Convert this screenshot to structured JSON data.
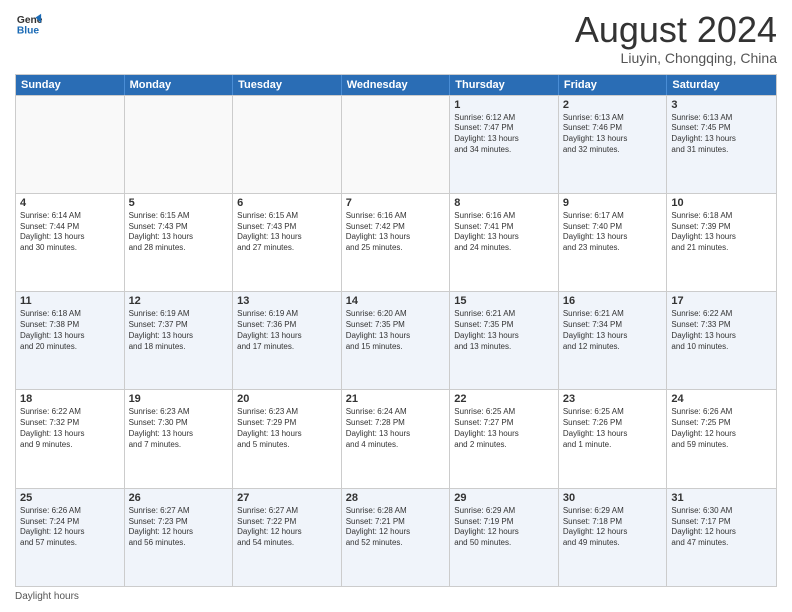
{
  "logo": {
    "line1": "General",
    "line2": "Blue"
  },
  "title": "August 2024",
  "subtitle": "Liuyin, Chongqing, China",
  "days_of_week": [
    "Sunday",
    "Monday",
    "Tuesday",
    "Wednesday",
    "Thursday",
    "Friday",
    "Saturday"
  ],
  "weeks": [
    [
      {
        "num": "",
        "info": ""
      },
      {
        "num": "",
        "info": ""
      },
      {
        "num": "",
        "info": ""
      },
      {
        "num": "",
        "info": ""
      },
      {
        "num": "1",
        "info": "Sunrise: 6:12 AM\nSunset: 7:47 PM\nDaylight: 13 hours\nand 34 minutes."
      },
      {
        "num": "2",
        "info": "Sunrise: 6:13 AM\nSunset: 7:46 PM\nDaylight: 13 hours\nand 32 minutes."
      },
      {
        "num": "3",
        "info": "Sunrise: 6:13 AM\nSunset: 7:45 PM\nDaylight: 13 hours\nand 31 minutes."
      }
    ],
    [
      {
        "num": "4",
        "info": "Sunrise: 6:14 AM\nSunset: 7:44 PM\nDaylight: 13 hours\nand 30 minutes."
      },
      {
        "num": "5",
        "info": "Sunrise: 6:15 AM\nSunset: 7:43 PM\nDaylight: 13 hours\nand 28 minutes."
      },
      {
        "num": "6",
        "info": "Sunrise: 6:15 AM\nSunset: 7:43 PM\nDaylight: 13 hours\nand 27 minutes."
      },
      {
        "num": "7",
        "info": "Sunrise: 6:16 AM\nSunset: 7:42 PM\nDaylight: 13 hours\nand 25 minutes."
      },
      {
        "num": "8",
        "info": "Sunrise: 6:16 AM\nSunset: 7:41 PM\nDaylight: 13 hours\nand 24 minutes."
      },
      {
        "num": "9",
        "info": "Sunrise: 6:17 AM\nSunset: 7:40 PM\nDaylight: 13 hours\nand 23 minutes."
      },
      {
        "num": "10",
        "info": "Sunrise: 6:18 AM\nSunset: 7:39 PM\nDaylight: 13 hours\nand 21 minutes."
      }
    ],
    [
      {
        "num": "11",
        "info": "Sunrise: 6:18 AM\nSunset: 7:38 PM\nDaylight: 13 hours\nand 20 minutes."
      },
      {
        "num": "12",
        "info": "Sunrise: 6:19 AM\nSunset: 7:37 PM\nDaylight: 13 hours\nand 18 minutes."
      },
      {
        "num": "13",
        "info": "Sunrise: 6:19 AM\nSunset: 7:36 PM\nDaylight: 13 hours\nand 17 minutes."
      },
      {
        "num": "14",
        "info": "Sunrise: 6:20 AM\nSunset: 7:35 PM\nDaylight: 13 hours\nand 15 minutes."
      },
      {
        "num": "15",
        "info": "Sunrise: 6:21 AM\nSunset: 7:35 PM\nDaylight: 13 hours\nand 13 minutes."
      },
      {
        "num": "16",
        "info": "Sunrise: 6:21 AM\nSunset: 7:34 PM\nDaylight: 13 hours\nand 12 minutes."
      },
      {
        "num": "17",
        "info": "Sunrise: 6:22 AM\nSunset: 7:33 PM\nDaylight: 13 hours\nand 10 minutes."
      }
    ],
    [
      {
        "num": "18",
        "info": "Sunrise: 6:22 AM\nSunset: 7:32 PM\nDaylight: 13 hours\nand 9 minutes."
      },
      {
        "num": "19",
        "info": "Sunrise: 6:23 AM\nSunset: 7:30 PM\nDaylight: 13 hours\nand 7 minutes."
      },
      {
        "num": "20",
        "info": "Sunrise: 6:23 AM\nSunset: 7:29 PM\nDaylight: 13 hours\nand 5 minutes."
      },
      {
        "num": "21",
        "info": "Sunrise: 6:24 AM\nSunset: 7:28 PM\nDaylight: 13 hours\nand 4 minutes."
      },
      {
        "num": "22",
        "info": "Sunrise: 6:25 AM\nSunset: 7:27 PM\nDaylight: 13 hours\nand 2 minutes."
      },
      {
        "num": "23",
        "info": "Sunrise: 6:25 AM\nSunset: 7:26 PM\nDaylight: 13 hours\nand 1 minute."
      },
      {
        "num": "24",
        "info": "Sunrise: 6:26 AM\nSunset: 7:25 PM\nDaylight: 12 hours\nand 59 minutes."
      }
    ],
    [
      {
        "num": "25",
        "info": "Sunrise: 6:26 AM\nSunset: 7:24 PM\nDaylight: 12 hours\nand 57 minutes."
      },
      {
        "num": "26",
        "info": "Sunrise: 6:27 AM\nSunset: 7:23 PM\nDaylight: 12 hours\nand 56 minutes."
      },
      {
        "num": "27",
        "info": "Sunrise: 6:27 AM\nSunset: 7:22 PM\nDaylight: 12 hours\nand 54 minutes."
      },
      {
        "num": "28",
        "info": "Sunrise: 6:28 AM\nSunset: 7:21 PM\nDaylight: 12 hours\nand 52 minutes."
      },
      {
        "num": "29",
        "info": "Sunrise: 6:29 AM\nSunset: 7:19 PM\nDaylight: 12 hours\nand 50 minutes."
      },
      {
        "num": "30",
        "info": "Sunrise: 6:29 AM\nSunset: 7:18 PM\nDaylight: 12 hours\nand 49 minutes."
      },
      {
        "num": "31",
        "info": "Sunrise: 6:30 AM\nSunset: 7:17 PM\nDaylight: 12 hours\nand 47 minutes."
      }
    ]
  ],
  "footer": "Daylight hours"
}
